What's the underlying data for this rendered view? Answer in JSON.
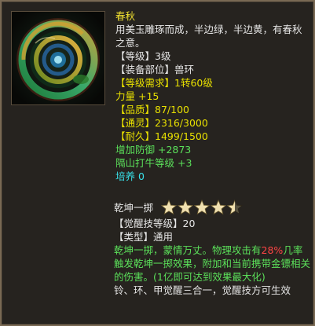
{
  "item": {
    "name": "春秋",
    "desc": "用美玉雕琢而成，半边绿，半边黄，有春秋之意。",
    "level": "【等级】3级",
    "slot": "【装备部位】兽环",
    "req": "【等级需求】1转60级",
    "str": "力量 +15",
    "quality": "【品质】87/100",
    "spirit": "【通灵】2316/3000",
    "durability": "【耐久】1499/1500",
    "def_add": "增加防御 +2873",
    "skill_level": "隔山打牛等级 +3",
    "cultivate": "培养 0"
  },
  "skill": {
    "name": "乾坤一掷",
    "rating": 4.5,
    "rating_max": 5,
    "awaken_level": "【觉醒技等级】20",
    "type": "【类型】通用",
    "effect_a": "乾坤一掷，蒙情万丈。物理攻击有",
    "effect_pct": "28%",
    "effect_b": "几率触发乾坤一掷效果，附加和当前携带金镖相关的伤害。",
    "effect_note": "(1亿即可达到效果最大化)",
    "combo": "铃、环、甲觉醒三合一，觉醒技方可生效"
  },
  "icon": {
    "name": "jade-ring-icon"
  }
}
